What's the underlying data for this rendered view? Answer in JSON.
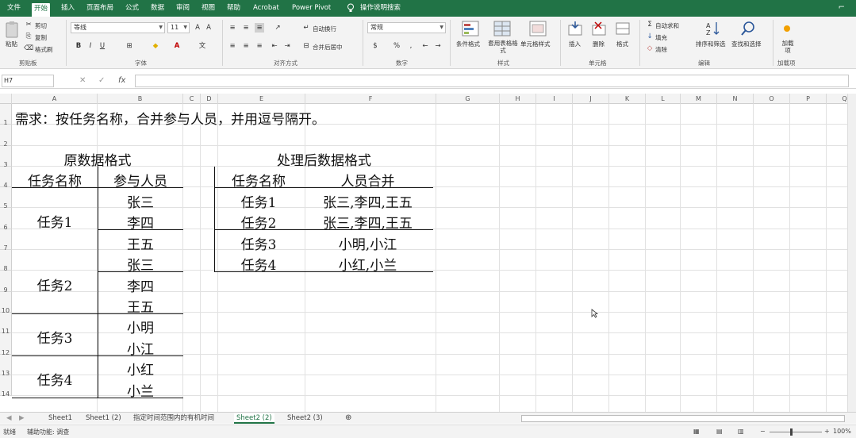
{
  "tabs": [
    "文件",
    "开始",
    "插入",
    "页面布局",
    "公式",
    "数据",
    "审阅",
    "视图",
    "帮助",
    "Acrobat",
    "Power Pivot"
  ],
  "active_tab": "开始",
  "tell_me": "操作说明搜索",
  "ribbon": {
    "clipboard": {
      "paste": "粘贴",
      "cut": "剪切",
      "copy": "复制",
      "format_painter": "格式刷",
      "label": "剪贴板"
    },
    "font": {
      "name": "等线",
      "size": "11",
      "label": "字体"
    },
    "alignment": {
      "wrap": "自动换行",
      "merge": "合并后居中",
      "label": "对齐方式"
    },
    "number": {
      "format": "常规",
      "label": "数字"
    },
    "styles": {
      "conditional": "条件格式",
      "table": "套用表格格式",
      "cell": "单元格样式",
      "label": "样式"
    },
    "cells": {
      "insert": "插入",
      "delete": "删除",
      "format": "格式",
      "label": "单元格"
    },
    "editing": {
      "autosum": "自动求和",
      "fill": "填充",
      "clear": "清除",
      "sort": "排序和筛选",
      "find": "查找和选择",
      "label": "编辑"
    },
    "addins": {
      "btn": "加载项",
      "label": "加载项"
    }
  },
  "formula_bar": {
    "name_box": "H7",
    "fx": "fx",
    "cancel": "✕",
    "enter": "✓"
  },
  "columns": [
    "A",
    "B",
    "C",
    "D",
    "E",
    "F",
    "G",
    "H",
    "I",
    "J",
    "K",
    "L",
    "M",
    "N",
    "O",
    "P",
    "Q"
  ],
  "rows": [
    "1",
    "2",
    "3",
    "4",
    "5",
    "6",
    "7",
    "8",
    "9",
    "10",
    "11",
    "12",
    "13",
    "14"
  ],
  "content": {
    "title": "需求：按任务名称，合并参与人员，并用逗号隔开。",
    "left_title": "原数据格式",
    "left_headers": [
      "任务名称",
      "参与人员"
    ],
    "left_groups": [
      {
        "task": "任务1",
        "people": [
          "张三",
          "李四"
        ]
      },
      {
        "task": "任务2",
        "people": [
          "王五",
          "张三",
          "李四",
          "王五"
        ]
      },
      {
        "task": "任务3",
        "people": [
          "小明",
          "小江"
        ]
      },
      {
        "task": "任务4",
        "people": [
          "小红",
          "小兰"
        ]
      }
    ],
    "right_title": "处理后数据格式",
    "right_headers": [
      "任务名称",
      "人员合并"
    ],
    "right_rows": [
      {
        "task": "任务1",
        "merged": "张三,李四,王五"
      },
      {
        "task": "任务2",
        "merged": "张三,李四,王五"
      },
      {
        "task": "任务3",
        "merged": "小明,小江"
      },
      {
        "task": "任务4",
        "merged": "小红,小兰"
      }
    ]
  },
  "sheets": [
    "Sheet1",
    "Sheet1 (2)",
    "指定时间范围内的有机时间",
    "Sheet2 (2)",
    "Sheet2 (3)"
  ],
  "active_sheet": "Sheet2 (2)",
  "status": {
    "ready": "就绪",
    "accessibility": "辅助功能: 调查",
    "zoom": "100%"
  },
  "colors": {
    "accent": "#217346"
  }
}
